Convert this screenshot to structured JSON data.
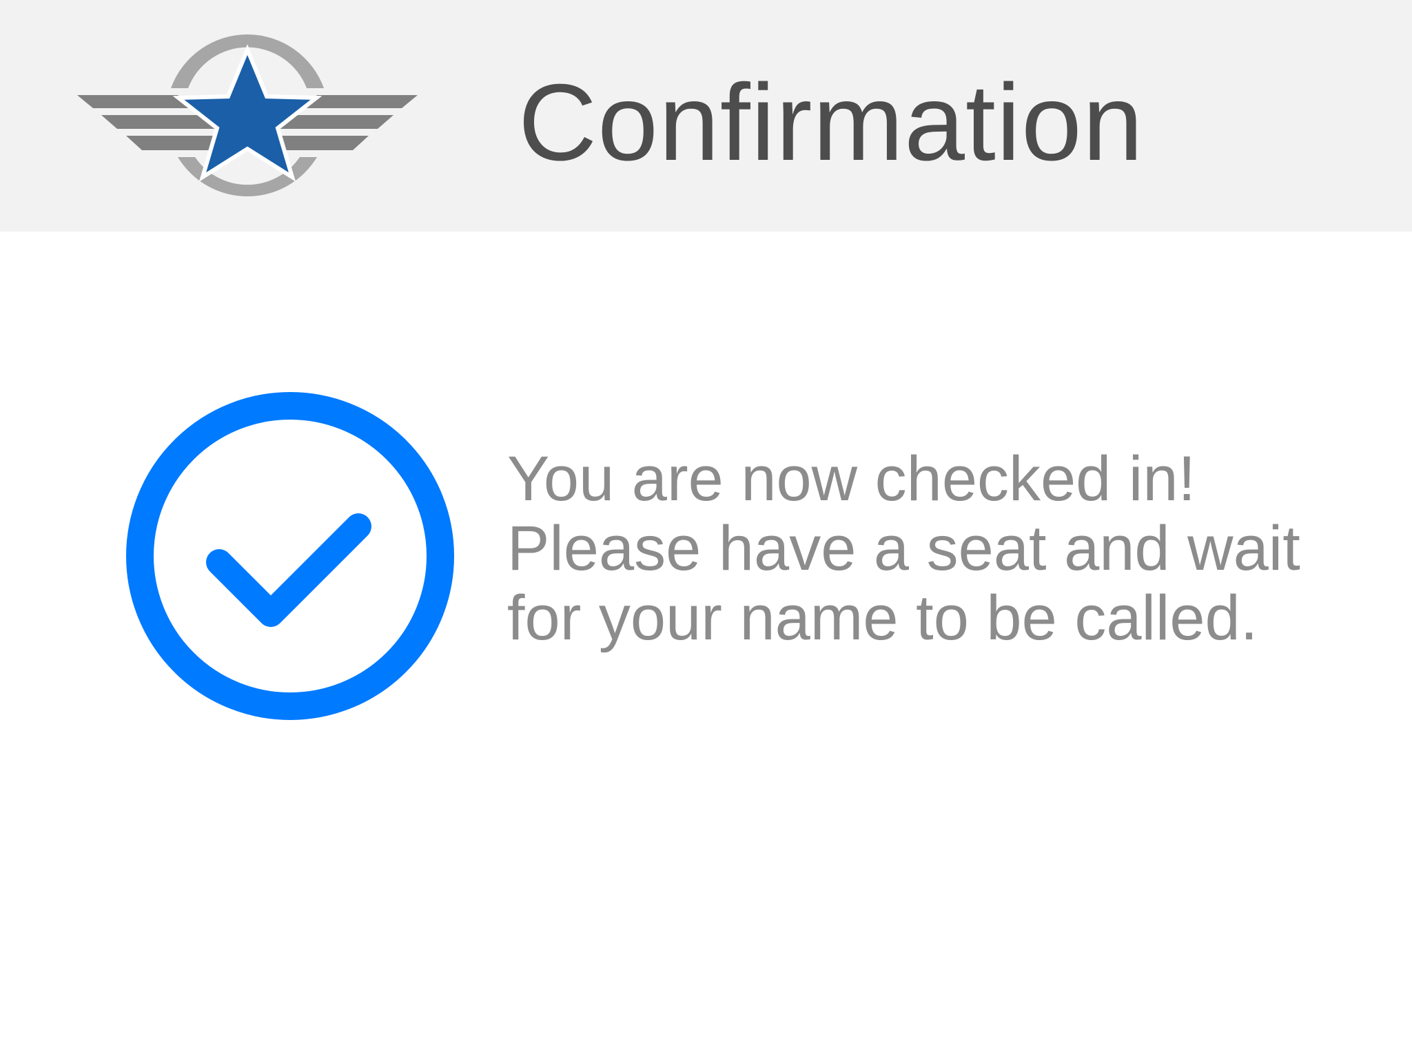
{
  "header": {
    "title": "Confirmation",
    "logo_icon": "winged-star-logo",
    "background_color": "#f2f2f2",
    "title_color": "#4d4d4d"
  },
  "confirmation": {
    "icon": "check-circle-icon",
    "accent_color": "#007aff",
    "message_lines": [
      "You are now checked in!",
      "Please have a seat and wait",
      "for your name to be called."
    ],
    "message_color": "#8c8c8c"
  }
}
